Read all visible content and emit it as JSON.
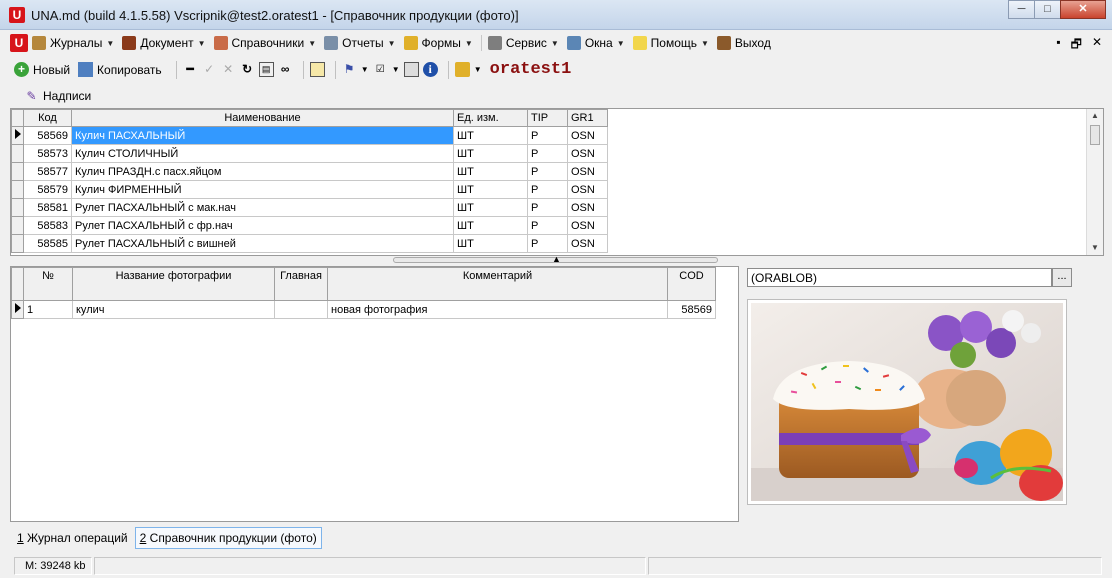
{
  "window": {
    "title": "UNA.md (build 4.1.5.58) Vscripnik@test2.oratest1 - [Справочник продукции (фото)]",
    "app_icon_letter": "U",
    "buttons": {
      "minimize": "─",
      "maximize": "□",
      "close": "✕"
    }
  },
  "menu": {
    "items": [
      {
        "label": "Журналы",
        "icon": "journal-icon",
        "color": "#b5873c"
      },
      {
        "label": "Документ",
        "icon": "document-icon",
        "color": "#8b3a1a"
      },
      {
        "label": "Справочники",
        "icon": "reference-icon",
        "color": "#c96b48"
      },
      {
        "label": "Отчеты",
        "icon": "reports-icon",
        "color": "#7a8fa8"
      },
      {
        "label": "Формы",
        "icon": "forms-icon",
        "color": "#e0b02a"
      },
      {
        "label": "Сервис",
        "icon": "service-icon",
        "color": "#7e7e7e"
      },
      {
        "label": "Окна",
        "icon": "windows-icon",
        "color": "#5b86b5"
      },
      {
        "label": "Помощь",
        "icon": "help-icon",
        "color": "#f2d64b"
      }
    ],
    "exit_label": "Выход",
    "mdi_controls": [
      "▪",
      "🗗",
      "✕"
    ]
  },
  "toolbar": {
    "new_label": "Новый",
    "copy_label": "Копировать",
    "db_name": "oratest1",
    "captions_label": "Надписи"
  },
  "products": {
    "columns": [
      "Код",
      "Наименование",
      "Ед. изм.",
      "TIP",
      "GR1"
    ],
    "rows": [
      {
        "code": "58569",
        "name": "Кулич ПАСХАЛЬНЫЙ",
        "unit": "ШТ",
        "tip": "P",
        "gr1": "OSN",
        "selected": true
      },
      {
        "code": "58573",
        "name": "Кулич СТОЛИЧНЫЙ",
        "unit": "ШТ",
        "tip": "P",
        "gr1": "OSN"
      },
      {
        "code": "58577",
        "name": "Кулич ПРАЗДН.с пасх.яйцом",
        "unit": "ШТ",
        "tip": "P",
        "gr1": "OSN"
      },
      {
        "code": "58579",
        "name": "Кулич ФИРМЕННЫЙ",
        "unit": "ШТ",
        "tip": "P",
        "gr1": "OSN"
      },
      {
        "code": "58581",
        "name": "Рулет ПАСХАЛЬНЫЙ с мак.нач",
        "unit": "ШТ",
        "tip": "P",
        "gr1": "OSN"
      },
      {
        "code": "58583",
        "name": "Рулет ПАСХАЛЬНЫЙ с фр.нач",
        "unit": "ШТ",
        "tip": "P",
        "gr1": "OSN"
      },
      {
        "code": "58585",
        "name": "Рулет ПАСХАЛЬНЫЙ с вишней",
        "unit": "ШТ",
        "tip": "P",
        "gr1": "OSN"
      }
    ]
  },
  "photos": {
    "columns": [
      "№",
      "Название фотографии",
      "Главная",
      "Комментарий",
      "COD"
    ],
    "rows": [
      {
        "num": "1",
        "title": "кулич",
        "main": "",
        "comment": "новая фотография",
        "cod": "58569"
      }
    ]
  },
  "blob": {
    "value": "(ORABLOB)",
    "button": "..."
  },
  "tabs": [
    {
      "num": "1",
      "label": " Журнал операций",
      "active": false
    },
    {
      "num": "2",
      "label": " Справочник продукции (фото)",
      "active": true
    }
  ],
  "status": {
    "memory": "M: 39248 kb"
  }
}
